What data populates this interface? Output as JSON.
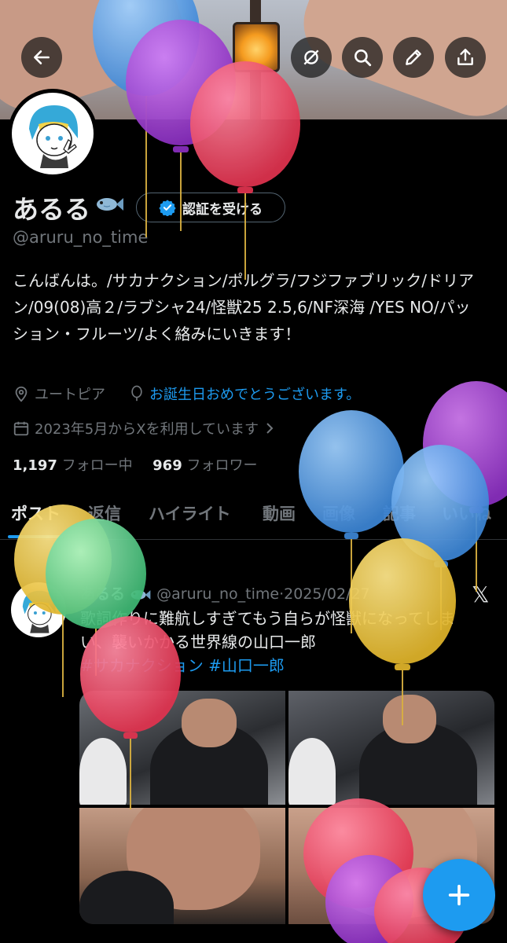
{
  "header": {
    "back_icon": "arrow-left-icon",
    "actions": [
      "shield-off-icon",
      "search-icon",
      "edit-icon",
      "share-icon"
    ]
  },
  "profile": {
    "name": "あるる",
    "name_emoji": "fish-icon",
    "verify_label": "認証を受ける",
    "handle": "@aruru_no_time",
    "bio": "こんばんは。/サカナクション/ポルグラ/フジファブリック/ドリアン/09(08)高２/ラブシャ24/怪獣25 2.5,6/NF深海 /YES NO/パッション・フルーツ/よく絡みにいきます！",
    "location": "ユートピア",
    "birthday": "お誕生日おめでとうございます。",
    "joined": "2023年5月からXを利用しています",
    "following_count": "1,197",
    "following_label": "フォロー中",
    "followers_count": "969",
    "followers_label": "フォロワー"
  },
  "tabs": [
    "ポスト",
    "返信",
    "ハイライト",
    "動画",
    "画像",
    "記事",
    "いいね"
  ],
  "active_tab": "ポスト",
  "post": {
    "author": "あるる",
    "handle": "@aruru_no_time",
    "separator": "·",
    "date": "2025/02/27",
    "text": "歌詞作りに難航しすぎてもう自らが怪獣になってしまい、襲いかかる世界線の山口一郎",
    "hashtag1": "#サカナクション",
    "hashtag2": "#山口一郎"
  },
  "colors": {
    "background": "#000000",
    "accent": "#1d9bf0",
    "muted": "#71767b",
    "text": "#e7e9ea"
  },
  "fab_icon": "plus-icon"
}
